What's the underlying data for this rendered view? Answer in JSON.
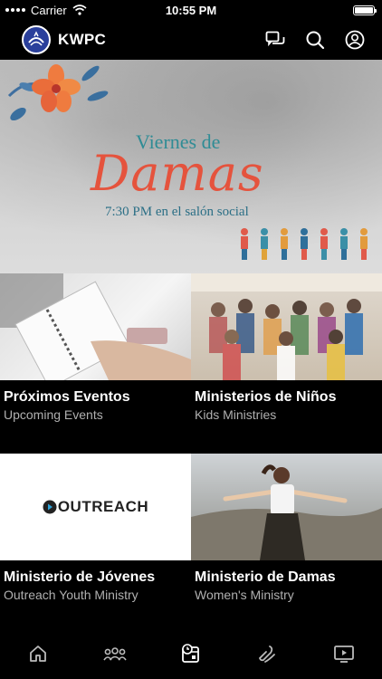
{
  "status_bar": {
    "carrier": "Carrier",
    "time": "10:55 PM"
  },
  "header": {
    "title": "KWPC",
    "icons": [
      "chat-icon",
      "search-icon",
      "profile-icon"
    ]
  },
  "hero": {
    "line1": "Viernes de",
    "line2": "Damas",
    "line3": "7:30 PM en el salón social"
  },
  "tiles": [
    {
      "title": "Próximos Eventos",
      "subtitle": "Upcoming Events"
    },
    {
      "title": "Ministerios de Niños",
      "subtitle": "Kids Ministries"
    },
    {
      "title": "Ministerio de Jóvenes",
      "subtitle": "Outreach Youth Ministry",
      "image_text": "OUTREACH"
    },
    {
      "title": "Ministerio de Damas",
      "subtitle": "Women's Ministry"
    }
  ],
  "tabbar": {
    "icons": [
      "home-icon",
      "groups-icon",
      "events-icon",
      "giving-icon",
      "media-icon"
    ],
    "active": "events-icon"
  }
}
